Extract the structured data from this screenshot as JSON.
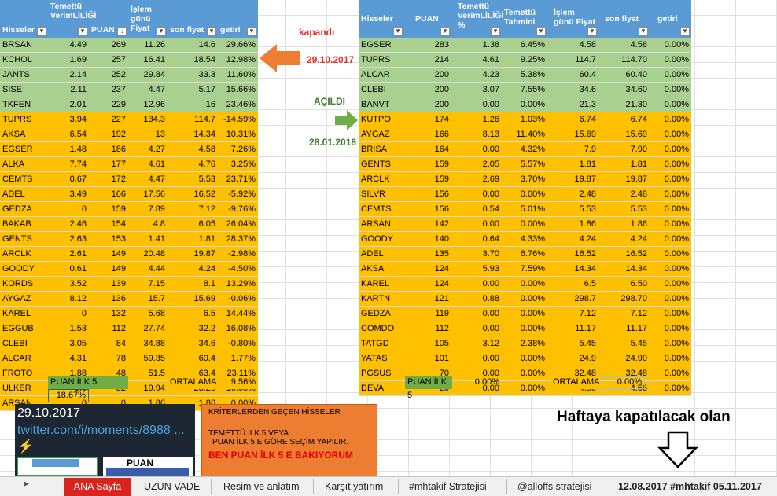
{
  "left_table": {
    "headers": [
      "Hisseler",
      "Temettü VerimLİLİĞİ",
      "PUAN",
      "İşlem günü Fiyat",
      "son fiyat",
      "getiri"
    ],
    "rows": [
      [
        "BRSAN",
        "4.49",
        "269",
        "11.26",
        "14.6",
        "29.66%",
        "g"
      ],
      [
        "KCHOL",
        "1.69",
        "257",
        "16.41",
        "18.54",
        "12.98%",
        "g"
      ],
      [
        "JANTS",
        "2.14",
        "252",
        "29.84",
        "33.3",
        "11.60%",
        "g"
      ],
      [
        "SISE",
        "2.11",
        "237",
        "4.47",
        "5.17",
        "15.66%",
        "g"
      ],
      [
        "TKFEN",
        "2.01",
        "229",
        "12.96",
        "16",
        "23.46%",
        "g"
      ],
      [
        "TUPRS",
        "3.94",
        "227",
        "134.3",
        "114.7",
        "-14.59%",
        "o"
      ],
      [
        "AKSA",
        "6.54",
        "192",
        "13",
        "14.34",
        "10.31%",
        "o"
      ],
      [
        "EGSER",
        "1.48",
        "186",
        "4.27",
        "4.58",
        "7.26%",
        "o"
      ],
      [
        "ALKA",
        "7.74",
        "177",
        "4.61",
        "4.76",
        "3.25%",
        "o"
      ],
      [
        "CEMTS",
        "0.67",
        "172",
        "4.47",
        "5.53",
        "23.71%",
        "o"
      ],
      [
        "ADEL",
        "3.49",
        "166",
        "17.56",
        "16.52",
        "-5.92%",
        "o"
      ],
      [
        "GEDZA",
        "0",
        "159",
        "7.89",
        "7.12",
        "-9.76%",
        "o"
      ],
      [
        "BAKAB",
        "2.46",
        "154",
        "4.8",
        "6.05",
        "26.04%",
        "o"
      ],
      [
        "GENTS",
        "2.63",
        "153",
        "1.41",
        "1.81",
        "28.37%",
        "o"
      ],
      [
        "ARCLK",
        "2.61",
        "149",
        "20.48",
        "19.87",
        "-2.98%",
        "o"
      ],
      [
        "GOODY",
        "0.61",
        "149",
        "4.44",
        "4.24",
        "-4.50%",
        "o"
      ],
      [
        "KORDS",
        "3.52",
        "139",
        "7.15",
        "8.1",
        "13.29%",
        "o"
      ],
      [
        "AYGAZ",
        "8.12",
        "136",
        "15.7",
        "15.69",
        "-0.06%",
        "o"
      ],
      [
        "KAREL",
        "0",
        "132",
        "5.68",
        "6.5",
        "14.44%",
        "o"
      ],
      [
        "EGGUB",
        "1.53",
        "112",
        "27.74",
        "32.2",
        "16.08%",
        "o"
      ],
      [
        "CLEBI",
        "3.05",
        "84",
        "34.88",
        "34.6",
        "-0.80%",
        "o"
      ],
      [
        "ALCAR",
        "4.31",
        "78",
        "59.35",
        "60.4",
        "1.77%",
        "o"
      ],
      [
        "FROTO",
        "1.88",
        "48",
        "51.5",
        "63.4",
        "23.11%",
        "o"
      ],
      [
        "ULKER",
        "0.8",
        "32",
        "19.94",
        "23.26",
        "16.65%",
        "o"
      ],
      [
        "ARSAN",
        "0",
        "0",
        "1.86",
        "1.86",
        "0.00%",
        "o"
      ]
    ],
    "puan_ilk5_label": "PUAN İLK 5",
    "puan_ilk5_value": "18.67%",
    "ortalama_label": "ORTALAMA",
    "ortalama_value": "9.56%"
  },
  "right_table": {
    "headers": [
      "Hisseler",
      "PUAN",
      "Temettü VerimLİLİĞİ %",
      "Temettü Tahmini",
      "İşlem günü Fiyat",
      "son fiyat",
      "getiri"
    ],
    "rows": [
      [
        "EGSER",
        "283",
        "1.38",
        "6.45%",
        "4.58",
        "4.58",
        "0.00%",
        "g"
      ],
      [
        "TUPRS",
        "214",
        "4.61",
        "9.25%",
        "114.7",
        "114.70",
        "0.00%",
        "g"
      ],
      [
        "ALCAR",
        "200",
        "4.23",
        "5.38%",
        "60.4",
        "60.40",
        "0.00%",
        "g"
      ],
      [
        "CLEBI",
        "200",
        "3.07",
        "7.55%",
        "34.6",
        "34.60",
        "0.00%",
        "g"
      ],
      [
        "BANVT",
        "200",
        "0.00",
        "0.00%",
        "21.3",
        "21.30",
        "0.00%",
        "g"
      ],
      [
        "KUTPO",
        "174",
        "1.26",
        "1.03%",
        "6.74",
        "6.74",
        "0.00%",
        "o"
      ],
      [
        "AYGAZ",
        "166",
        "8.13",
        "11.40%",
        "15.69",
        "15.69",
        "0.00%",
        "o"
      ],
      [
        "BRISA",
        "164",
        "0.00",
        "4.32%",
        "7.9",
        "7.90",
        "0.00%",
        "o"
      ],
      [
        "GENTS",
        "159",
        "2.05",
        "5.57%",
        "1.81",
        "1.81",
        "0.00%",
        "o"
      ],
      [
        "ARCLK",
        "159",
        "2.69",
        "3.70%",
        "19.87",
        "19.87",
        "0.00%",
        "o"
      ],
      [
        "SILVR",
        "156",
        "0.00",
        "0.00%",
        "2.48",
        "2.48",
        "0.00%",
        "o"
      ],
      [
        "CEMTS",
        "156",
        "0.54",
        "5.01%",
        "5.53",
        "5.53",
        "0.00%",
        "o"
      ],
      [
        "ARSAN",
        "142",
        "0.00",
        "0.00%",
        "1.86",
        "1.86",
        "0.00%",
        "o"
      ],
      [
        "GOODY",
        "140",
        "0.64",
        "4.33%",
        "4.24",
        "4.24",
        "0.00%",
        "o"
      ],
      [
        "ADEL",
        "135",
        "3.70",
        "6.76%",
        "16.52",
        "16.52",
        "0.00%",
        "o"
      ],
      [
        "AKSA",
        "124",
        "5.93",
        "7.59%",
        "14.34",
        "14.34",
        "0.00%",
        "o"
      ],
      [
        "KAREL",
        "124",
        "0.00",
        "0.00%",
        "6.5",
        "6.50",
        "0.00%",
        "o"
      ],
      [
        "KARTN",
        "121",
        "0.88",
        "0.00%",
        "298.7",
        "298.70",
        "0.00%",
        "o"
      ],
      [
        "GEDZA",
        "119",
        "0.00",
        "0.00%",
        "7.12",
        "7.12",
        "0.00%",
        "o"
      ],
      [
        "COMDO",
        "112",
        "0.00",
        "0.00%",
        "11.17",
        "11.17",
        "0.00%",
        "o"
      ],
      [
        "TATGD",
        "105",
        "3.12",
        "2.38%",
        "5.45",
        "5.45",
        "0.00%",
        "o"
      ],
      [
        "YATAS",
        "101",
        "0.00",
        "0.00%",
        "24.9",
        "24.90",
        "0.00%",
        "o"
      ],
      [
        "PGSUS",
        "70",
        "0.00",
        "0.00%",
        "32.48",
        "32.48",
        "0.00%",
        "o"
      ],
      [
        "DEVA",
        "20",
        "0.00",
        "0.00%",
        "4.56",
        "4.56",
        "0.00%",
        "o"
      ]
    ],
    "puan_ilk5_label": "PUAN İLK 5",
    "puan_ilk5_value": "0.00%",
    "ortalama_label": "ORTALAMA",
    "ortalama_value": "0.00%"
  },
  "annotations": {
    "kapandi": "kapandı",
    "date_closed": "29.10.2017",
    "acildi": "AÇILDI",
    "date_opened": "28.01.2018",
    "next_week": "Haftaya kapatılacak olan"
  },
  "tweet_card": {
    "date": "29.10.2017",
    "link": "twitter.com/i/moments/8988 ...",
    "emoji": "⚡",
    "thumb_label": "PUAN"
  },
  "criteria_box": {
    "title": "KRİTERLERDEN GEÇEN HİSSELER",
    "line1": "TEMETTÜ İLK 5 VEYA",
    "line2": "PUAN İLK 5 E GÖRE SEÇİM YAPILIR.",
    "line3": "BEN PUAN İLK 5 E BAKIYORUM"
  },
  "sheet_tabs": [
    "ANA Sayfa",
    "UZUN VADE",
    "Resim ve anlatım",
    "Karşıt yatırım",
    "#mhtakif Stratejisi",
    "@alloffs stratejisi",
    "12.08.2017 #mhtakif 05.11.2017"
  ],
  "colors": {
    "header": "#5b9bd5",
    "green": "#a9d08e",
    "orange": "#ffc000",
    "arrow_orange": "#ed7d31",
    "arrow_green": "#70ad47",
    "active_tab": "#d9241e"
  }
}
